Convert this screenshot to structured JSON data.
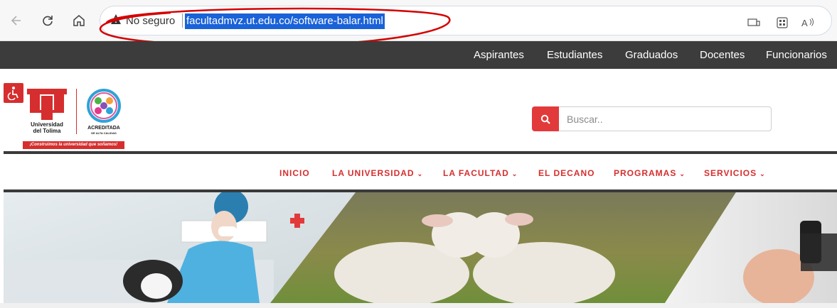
{
  "browser": {
    "security_label": "No seguro",
    "url": "facultadmvz.ut.edu.co/software-balar.html",
    "icons": [
      "back-icon",
      "reload-icon",
      "home-icon",
      "warning-icon",
      "extensions-icon",
      "apps-icon",
      "read-aloud-icon"
    ]
  },
  "top_nav": {
    "items": [
      "Aspirantes",
      "Estudiantes",
      "Graduados",
      "Docentes",
      "Funcionarios"
    ]
  },
  "header": {
    "logo_name_line1": "Universidad",
    "logo_name_line2": "del Tolima",
    "acreditada": "ACREDITADA",
    "acreditada_sub": "DE ALTA CALIDAD",
    "tagline": "¡Construimos la universidad que soñamos!",
    "search_placeholder": "Buscar.."
  },
  "main_nav": {
    "items": [
      {
        "label": "INICIO",
        "has_dropdown": false
      },
      {
        "label": "LA UNIVERSIDAD",
        "has_dropdown": true
      },
      {
        "label": "LA FACULTAD",
        "has_dropdown": true
      },
      {
        "label": "EL DECANO",
        "has_dropdown": false
      },
      {
        "label": "PROGRAMAS",
        "has_dropdown": true
      },
      {
        "label": "SERVICIOS",
        "has_dropdown": true
      }
    ]
  },
  "colors": {
    "brand_red": "#d62e2e",
    "dark_bar": "#3c3c3c",
    "url_highlight": "#1a62d8"
  }
}
